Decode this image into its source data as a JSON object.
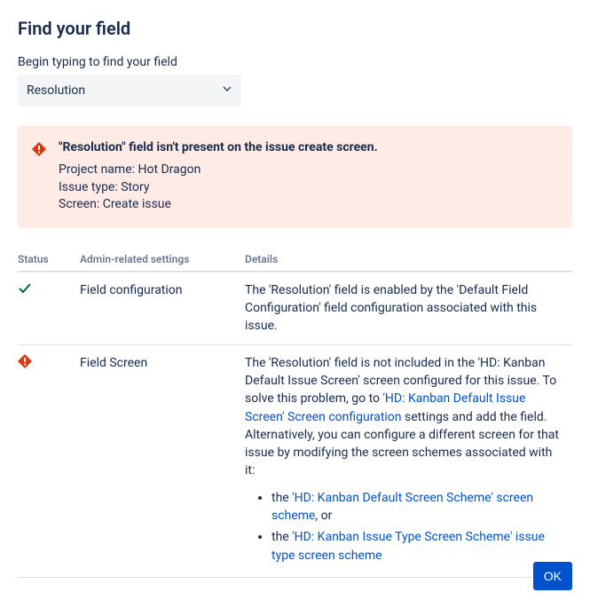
{
  "title": "Find your field",
  "searchLabel": "Begin typing to find your field",
  "selectedField": "Resolution",
  "alert": {
    "title": "\"Resolution\" field isn't present on the issue create screen.",
    "projectLabel": "Project name: ",
    "projectName": "Hot Dragon",
    "issueTypeLabel": "Issue type: ",
    "issueType": "Story",
    "screenLabel": "Screen: ",
    "screen": "Create issue"
  },
  "columns": {
    "status": "Status",
    "admin": "Admin-related settings",
    "details": "Details"
  },
  "rows": [
    {
      "status": "ok",
      "admin": "Field configuration",
      "detailsPlain": "The 'Resolution' field is enabled by the 'Default Field Configuration' field configuration associated with this issue."
    },
    {
      "status": "error",
      "admin": "Field Screen",
      "detailsPrefix": "The 'Resolution' field is not included in the 'HD: Kanban Default Issue Screen' screen configured for this issue. To solve this problem, go to ",
      "detailsLink1": "'HD: Kanban Default Issue Screen' Screen configuration",
      "detailsSuffix": " settings and add the field. Alternatively, you can configure a different screen for that issue by modifying the screen schemes associated with it:",
      "listItems": [
        {
          "prefix": "the ",
          "link": "'HD: Kanban Default Screen Scheme' screen scheme",
          "suffix": ", or"
        },
        {
          "prefix": "the ",
          "link": "'HD: Kanban Issue Type Screen Scheme' issue type screen scheme",
          "suffix": ""
        }
      ]
    }
  ],
  "okLabel": "OK"
}
